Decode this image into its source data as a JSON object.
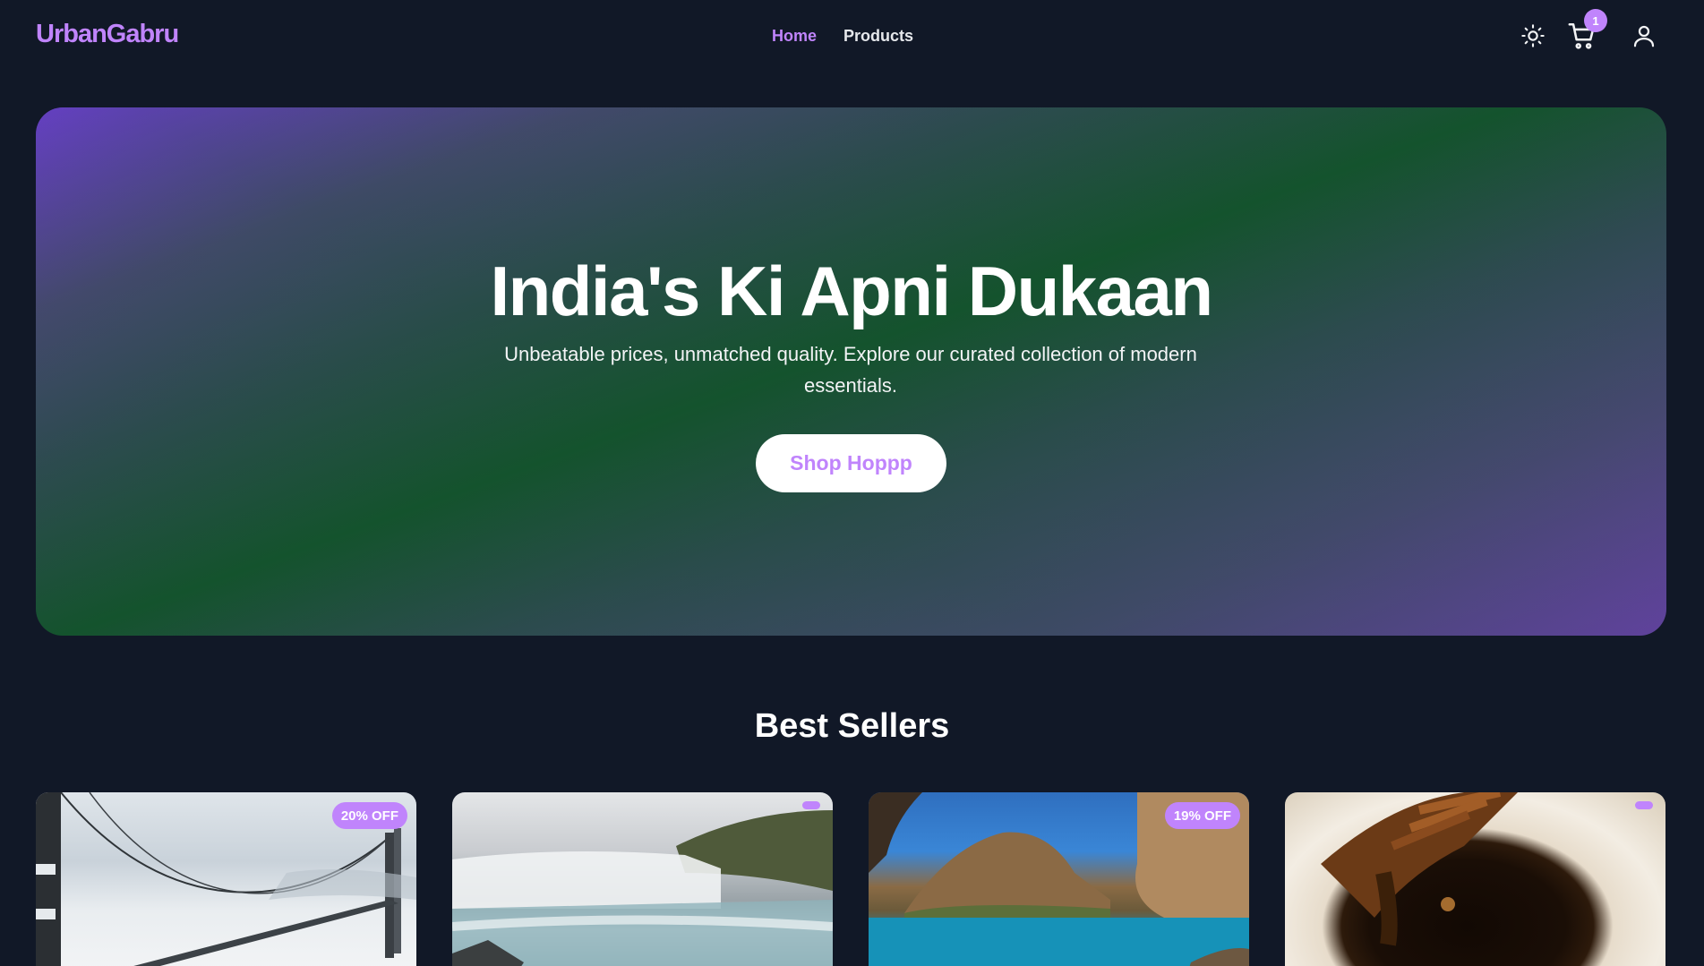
{
  "brand": {
    "name": "UrbanGabru"
  },
  "nav": {
    "items": [
      {
        "label": "Home",
        "active": true
      },
      {
        "label": "Products",
        "active": false
      }
    ]
  },
  "header_actions": {
    "theme_icon": "sun-icon",
    "cart_icon": "cart-icon",
    "cart_count": "1",
    "user_icon": "user-icon"
  },
  "hero": {
    "title": "India's Ki Apni Dukaan",
    "subtitle": "Unbeatable prices, unmatched quality. Explore our curated collection of modern essentials.",
    "cta_label": "Shop Hoppp"
  },
  "best_sellers": {
    "title": "Best Sellers",
    "products": [
      {
        "image": "bridge-in-fog",
        "discount": "20% OFF"
      },
      {
        "image": "waterfall",
        "discount": ""
      },
      {
        "image": "island-cove",
        "discount": "19% OFF"
      },
      {
        "image": "honey-dipper",
        "discount": ""
      }
    ]
  },
  "colors": {
    "background": "#111827",
    "accent": "#c084fc",
    "text": "#ffffff"
  }
}
